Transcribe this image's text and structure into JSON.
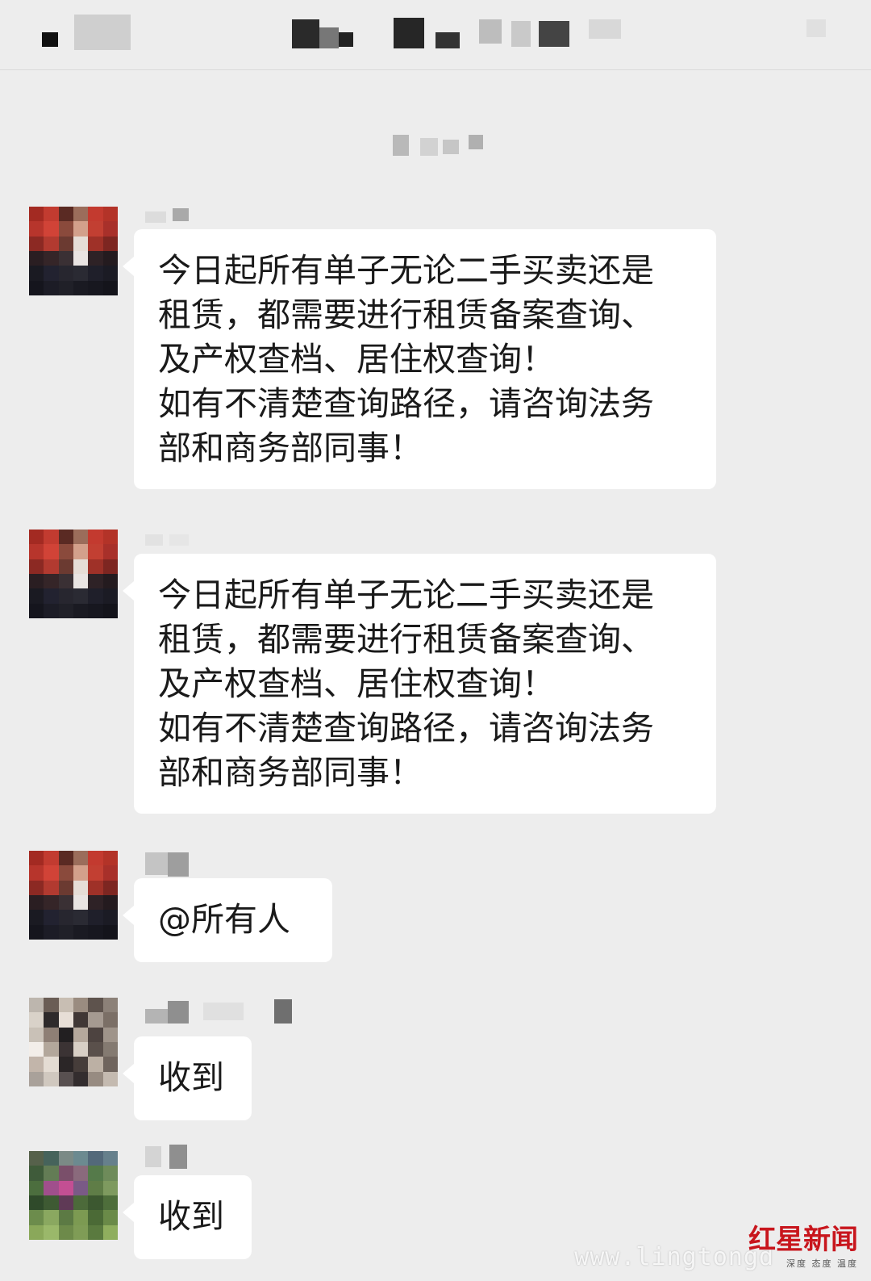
{
  "messages": [
    {
      "text": "今日起所有单子无论二手买卖还是\n租赁，都需要进行租赁备案查询、\n及产权查档、居住权查询！\n如有不清楚查询路径，请咨询法务\n部和商务部同事！"
    },
    {
      "text": "今日起所有单子无论二手买卖还是\n租赁，都需要进行租赁备案查询、\n及产权查档、居住权查询！\n如有不清楚查询路径，请咨询法务\n部和商务部同事！"
    },
    {
      "text": "@所有人"
    },
    {
      "text": "收到"
    },
    {
      "text": "收到"
    }
  ],
  "watermark": {
    "url": "www.lingtongd",
    "logo": "红星新闻",
    "tagline": "深度 态度 温度"
  },
  "colors": {
    "background": "#ededed",
    "bubble": "#ffffff",
    "brand": "#c8161d"
  }
}
